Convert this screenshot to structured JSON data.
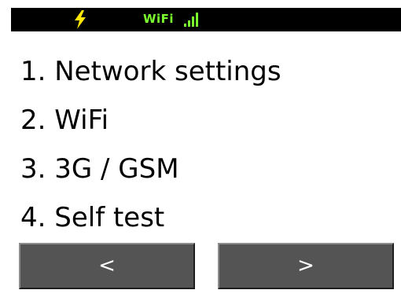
{
  "status_bar": {
    "power_icon": "lightning-bolt-icon",
    "wifi_label": "WiFi",
    "signal_icon": "signal-bars-icon",
    "background_color": "#000000",
    "wifi_color": "#7bff2e",
    "bolt_color": "#ffe600"
  },
  "menu": {
    "items": [
      {
        "label": "1. Network settings"
      },
      {
        "label": "2. WiFi"
      },
      {
        "label": "3. 3G / GSM"
      },
      {
        "label": "4. Self test"
      }
    ]
  },
  "nav": {
    "prev_label": "<",
    "next_label": ">",
    "button_color": "#545454"
  }
}
